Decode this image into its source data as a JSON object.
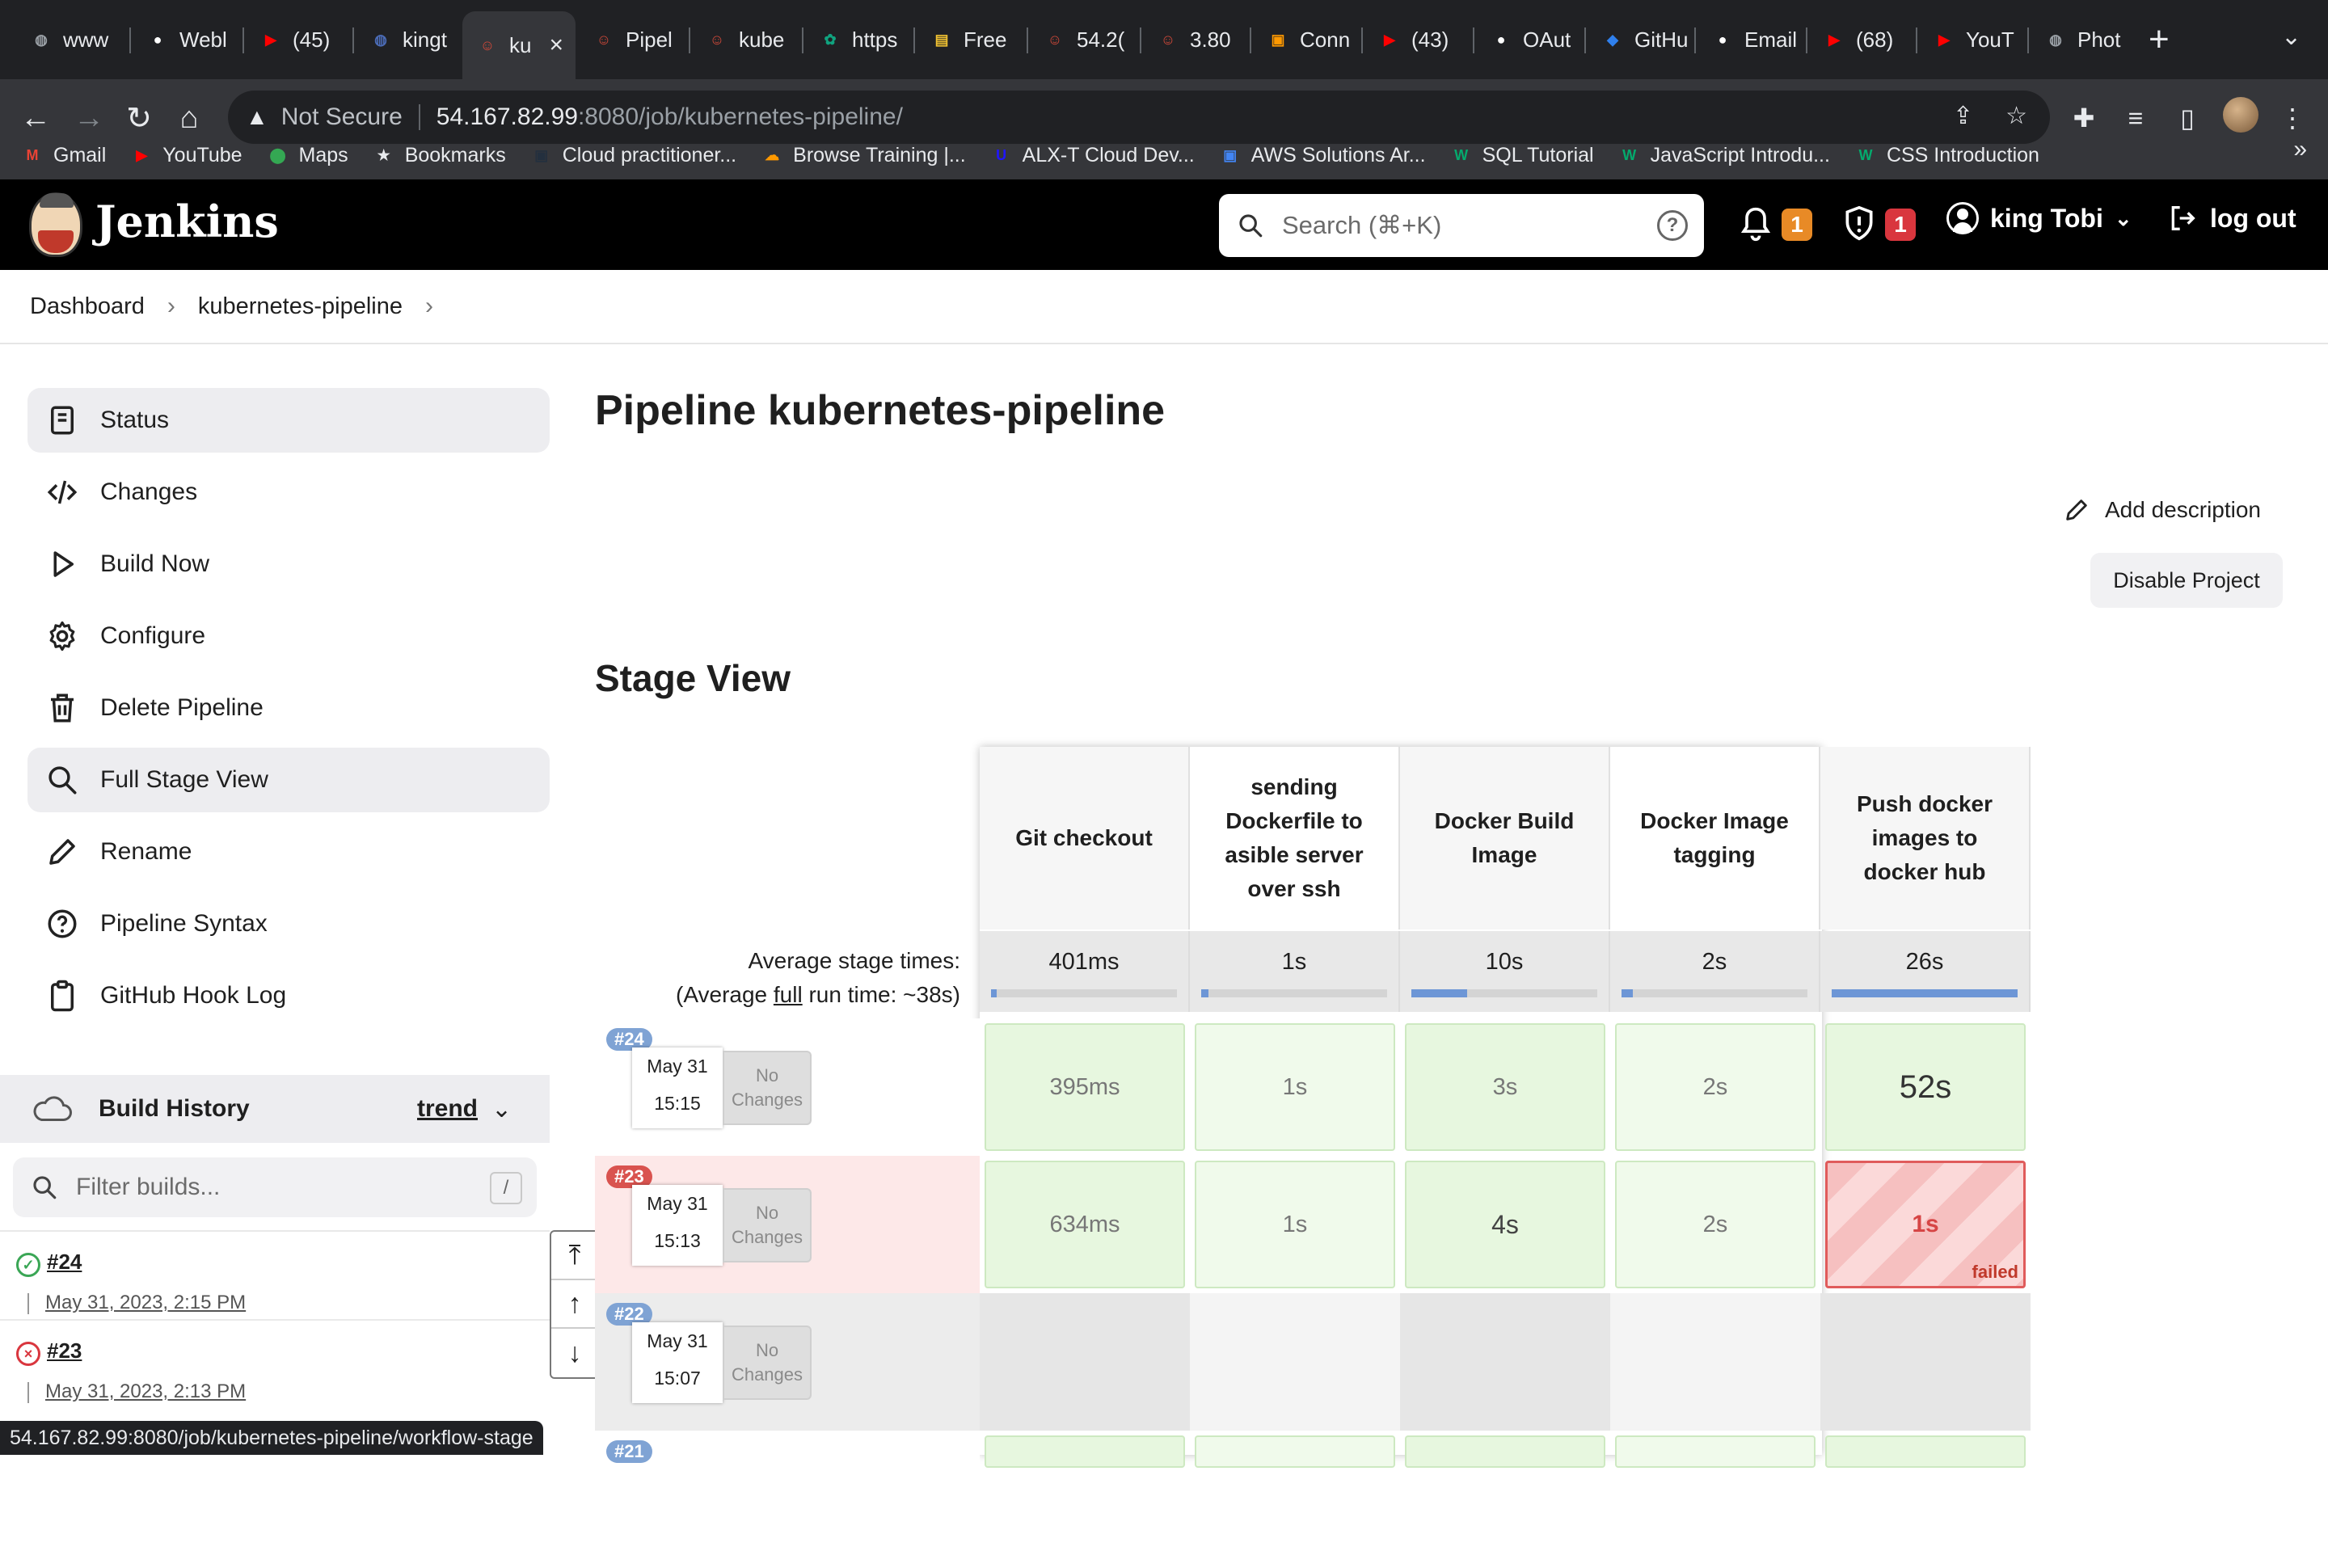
{
  "browser": {
    "tabs": [
      {
        "label": "www",
        "icon": "globe-icon",
        "color": "#9aa0a6"
      },
      {
        "label": "Webl",
        "icon": "github-icon",
        "color": "#ffffff"
      },
      {
        "label": "(45)",
        "icon": "youtube-icon",
        "color": "#ff0000"
      },
      {
        "label": "kingt",
        "icon": "globe-icon",
        "color": "#4b6cb7"
      },
      {
        "label": "ku",
        "icon": "jenkins-icon",
        "color": "#d24939",
        "active": true
      },
      {
        "label": "Pipel",
        "icon": "jenkins-icon",
        "color": "#d24939"
      },
      {
        "label": "kube",
        "icon": "jenkins-icon",
        "color": "#d24939"
      },
      {
        "label": "https",
        "icon": "openai-icon",
        "color": "#10a37f"
      },
      {
        "label": "Free",
        "icon": "doc-icon",
        "color": "#f1c232"
      },
      {
        "label": "54.2(",
        "icon": "jenkins-icon",
        "color": "#d24939"
      },
      {
        "label": "3.80",
        "icon": "jenkins-icon",
        "color": "#d24939"
      },
      {
        "label": "Conn",
        "icon": "aws-icon",
        "color": "#ff9900"
      },
      {
        "label": "(43)",
        "icon": "youtube-icon",
        "color": "#ff0000"
      },
      {
        "label": "OAut",
        "icon": "github-icon",
        "color": "#ffffff"
      },
      {
        "label": "GitHu",
        "icon": "vscode-icon",
        "color": "#2f80ed"
      },
      {
        "label": "Email",
        "icon": "github-icon",
        "color": "#ffffff"
      },
      {
        "label": "(68)",
        "icon": "youtube-icon",
        "color": "#ff0000"
      },
      {
        "label": "YouT",
        "icon": "youtube-icon",
        "color": "#ff0000"
      },
      {
        "label": "Phot",
        "icon": "globe-icon",
        "color": "#9aa0a6"
      }
    ],
    "security_label": "Not Secure",
    "url_host": "54.167.82.99",
    "url_path": ":8080/job/kubernetes-pipeline/",
    "bookmarks": [
      {
        "label": "Gmail",
        "icon": "gmail-icon",
        "color": "#ea4335"
      },
      {
        "label": "YouTube",
        "icon": "youtube-icon",
        "color": "#ff0000"
      },
      {
        "label": "Maps",
        "icon": "maps-icon",
        "color": "#34a853"
      },
      {
        "label": "Bookmarks",
        "icon": "star-icon",
        "color": "#e8eaed"
      },
      {
        "label": "Cloud practitioner...",
        "icon": "aws-icon",
        "color": "#232f3e"
      },
      {
        "label": "Browse Training |...",
        "icon": "cloud-icon",
        "color": "#ff9900"
      },
      {
        "label": "ALX-T Cloud Dev...",
        "icon": "udacity-icon",
        "color": "#2015ff"
      },
      {
        "label": "AWS Solutions Ar...",
        "icon": "aws-icon",
        "color": "#4285f4"
      },
      {
        "label": "SQL Tutorial",
        "icon": "w3-icon",
        "color": "#04aa6d"
      },
      {
        "label": "JavaScript Introdu...",
        "icon": "w3-icon",
        "color": "#04aa6d"
      },
      {
        "label": "CSS Introduction",
        "icon": "w3-icon",
        "color": "#04aa6d"
      }
    ],
    "status_url": "54.167.82.99:8080/job/kubernetes-pipeline/workflow-stage"
  },
  "jenkins": {
    "brand": "Jenkins",
    "search_placeholder": "Search (⌘+K)",
    "notifications_count": "1",
    "security_count": "1",
    "user": "king Tobi",
    "logout": "log out",
    "colors": {
      "notif_badge": "#e88a26",
      "security_badge": "#d9363e"
    }
  },
  "breadcrumb": [
    "Dashboard",
    "kubernetes-pipeline"
  ],
  "sidebar": {
    "items": [
      {
        "label": "Status",
        "icon": "status-icon",
        "active": true
      },
      {
        "label": "Changes",
        "icon": "code-icon"
      },
      {
        "label": "Build Now",
        "icon": "play-icon"
      },
      {
        "label": "Configure",
        "icon": "gear-icon"
      },
      {
        "label": "Delete Pipeline",
        "icon": "trash-icon"
      },
      {
        "label": "Full Stage View",
        "icon": "search-icon",
        "active": true
      },
      {
        "label": "Rename",
        "icon": "pencil-icon"
      },
      {
        "label": "Pipeline Syntax",
        "icon": "help-icon"
      },
      {
        "label": "GitHub Hook Log",
        "icon": "clipboard-icon"
      }
    ]
  },
  "build_history": {
    "title": "Build History",
    "trend": "trend",
    "filter_placeholder": "Filter builds...",
    "filter_shortcut": "/",
    "builds": [
      {
        "number": "#24",
        "date": "May 31, 2023, 2:15 PM",
        "status": "success"
      },
      {
        "number": "#23",
        "date": "May 31, 2023, 2:13 PM",
        "status": "failed"
      }
    ]
  },
  "main": {
    "title": "Pipeline kubernetes-pipeline",
    "add_description": "Add description",
    "disable_project": "Disable Project",
    "stage_view_title": "Stage View"
  },
  "stage_view": {
    "stages": [
      "Git checkout",
      "sending Dockerfile to asible server over ssh",
      "Docker Build Image",
      "Docker Image tagging",
      "Push docker images to docker hub"
    ],
    "avg_label_1": "Average stage times:",
    "avg_label_2_pre": "(Average ",
    "avg_label_2_full": "full",
    "avg_label_2_post": " run time: ~38s)",
    "avg_times": [
      "401ms",
      "1s",
      "10s",
      "2s",
      "26s"
    ],
    "avg_bar_fraction": [
      0.03,
      0.04,
      0.3,
      0.06,
      1.0
    ],
    "no_changes": "No Changes",
    "runs": [
      {
        "badge": "#24",
        "badge_color": "#7fa3d4",
        "date": "May 31",
        "time": "15:15",
        "status": "success",
        "cells": [
          "395ms",
          "1s",
          "3s",
          "2s",
          "52s"
        ],
        "cell_status": [
          "ok",
          "ok",
          "ok",
          "ok",
          "ok"
        ]
      },
      {
        "badge": "#23",
        "badge_color": "#d9534f",
        "date": "May 31",
        "time": "15:13",
        "status": "failed",
        "cells": [
          "634ms",
          "1s",
          "4s",
          "2s",
          "1s"
        ],
        "cell_status": [
          "ok",
          "ok",
          "ok",
          "ok",
          "failed"
        ],
        "failed_label": "failed"
      },
      {
        "badge": "#22",
        "badge_color": "#7fa3d4",
        "date": "May 31",
        "time": "15:07",
        "status": "aborted",
        "cells": [
          "",
          "",
          "",
          "",
          ""
        ],
        "cell_status": [
          "empty",
          "empty",
          "empty",
          "empty",
          "empty"
        ]
      },
      {
        "badge": "#21",
        "badge_color": "#7fa3d4",
        "date": "",
        "time": "",
        "status": "success",
        "cells": [
          "",
          "",
          "",
          "",
          ""
        ],
        "cell_status": [
          "ok",
          "ok",
          "ok",
          "ok",
          "ok"
        ]
      }
    ]
  }
}
